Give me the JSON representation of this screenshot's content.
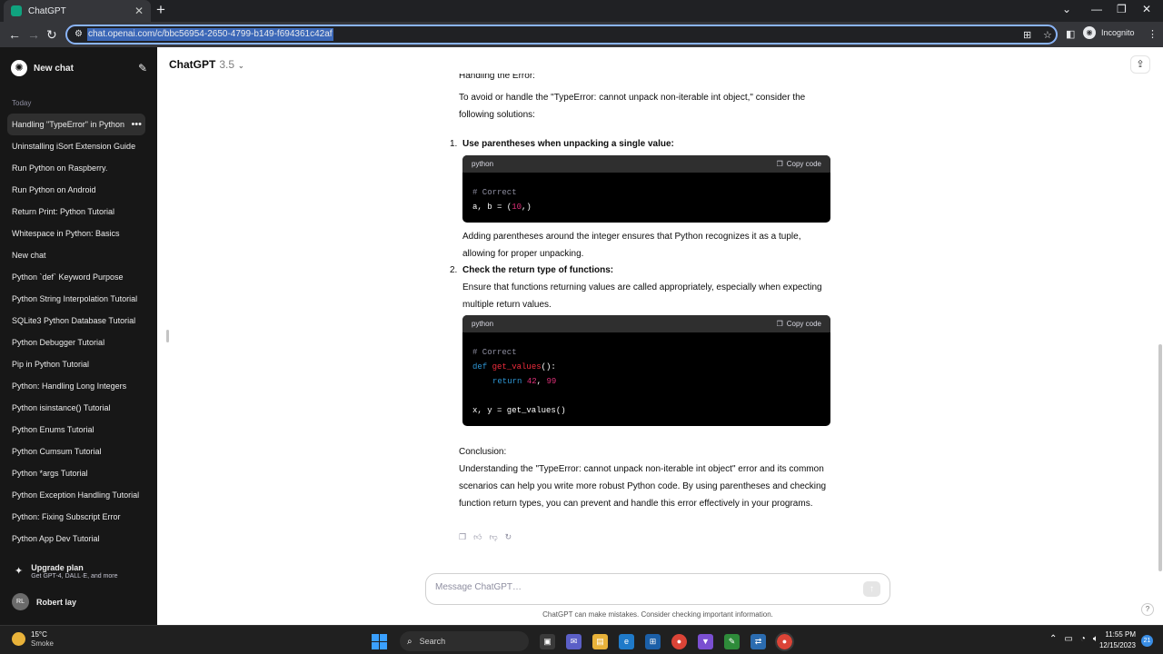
{
  "browser": {
    "tab_title": "ChatGPT",
    "tab_close": "✕",
    "new_tab": "+",
    "url": "chat.openai.com/c/bbc56954-2650-4799-b149-f694361c42af",
    "incognito_label": "Incognito"
  },
  "sidebar": {
    "new_chat_label": "New chat",
    "section_today": "Today",
    "chats": [
      "Handling \"TypeError\" in Python",
      "Uninstalling iSort Extension Guide",
      "Run Python on Raspberry.",
      "Run Python on Android",
      "Return Print: Python Tutorial",
      "Whitespace in Python: Basics",
      "New chat",
      "Python `def` Keyword Purpose",
      "Python String Interpolation Tutorial",
      "SQLite3 Python Database Tutorial",
      "Python Debugger Tutorial",
      "Pip in Python Tutorial",
      "Python: Handling Long Integers",
      "Python isinstance() Tutorial",
      "Python Enums Tutorial",
      "Python Cumsum Tutorial",
      "Python *args Tutorial",
      "Python Exception Handling Tutorial",
      "Python: Fixing Subscript Error",
      "Python App Dev Tutorial"
    ],
    "upgrade_title": "Upgrade plan",
    "upgrade_subtitle": "Get GPT-4, DALL·E, and more",
    "user_initials": "RL",
    "user_name": "Robert lay"
  },
  "header": {
    "model_name": "ChatGPT",
    "model_version": "3.5"
  },
  "message": {
    "cut_heading": "Handling the Error:",
    "intro": "To avoid or handle the \"TypeError: cannot unpack non-iterable int object,\" consider the following solutions:",
    "item1_number": "1.",
    "item1_title": "Use parentheses when unpacking a single value:",
    "code1": {
      "lang": "python",
      "copy_label": "Copy code",
      "comment": "# Correct",
      "line1_pre": "a, b = (",
      "line1_num": "10",
      "line1_post": ",)"
    },
    "item1_text": "Adding parentheses around the integer ensures that Python recognizes it as a tuple, allowing for proper unpacking.",
    "item2_number": "2.",
    "item2_title": "Check the return type of functions:",
    "item2_text": "Ensure that functions returning values are called appropriately, especially when expecting multiple return values.",
    "code2": {
      "lang": "python",
      "copy_label": "Copy code",
      "comment": "# Correct",
      "kw_def": "def",
      "fn_name": "get_values",
      "def_rest": "():",
      "kw_return": "return",
      "ret_a": "42",
      "ret_sep": ", ",
      "ret_b": "99",
      "last_line": "x, y = get_values()"
    },
    "conclusion_heading": "Conclusion:",
    "conclusion": "Understanding the \"TypeError: cannot unpack non-iterable int object\" error and its common scenarios can help you write more robust Python code. By using parentheses and checking function return types, you can prevent and handle this error effectively in your programs."
  },
  "composer": {
    "placeholder": "Message ChatGPT…",
    "disclaimer": "ChatGPT can make mistakes. Consider checking important information."
  },
  "help_label": "?",
  "taskbar": {
    "temperature": "15°C",
    "weather": "Smoke",
    "search_label": "Search",
    "time": "11:55 PM",
    "date": "12/15/2023",
    "notification_count": "21"
  }
}
